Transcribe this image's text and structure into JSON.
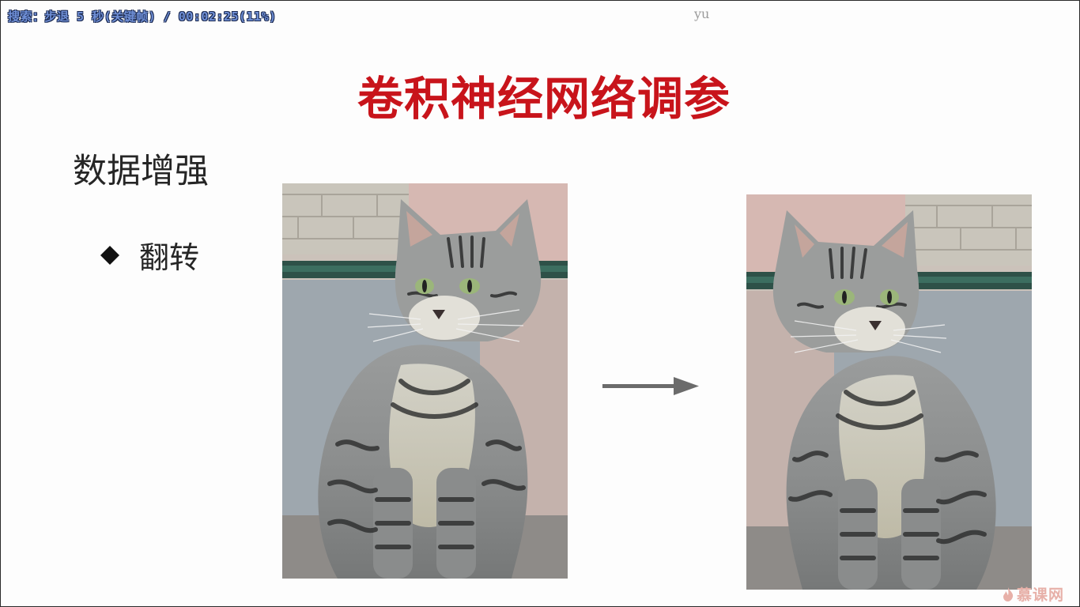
{
  "player": {
    "osd_text": "搜索：步退 5 秒(关键帧) / 00:02:25(11%)",
    "watermark_text": "yu",
    "brand_label": "慕课网",
    "brand_color": "#e7b0a8"
  },
  "slide": {
    "title": "卷积神经网络调参",
    "title_color": "#c8141b",
    "section_heading": "数据增强",
    "bullet": {
      "icon": "diamond-bullet-icon",
      "label": "翻转"
    },
    "images": {
      "original": "cat-photo",
      "flipped": "cat-photo-flipped-horizontally"
    },
    "arrow_icon": "right-arrow-icon"
  }
}
